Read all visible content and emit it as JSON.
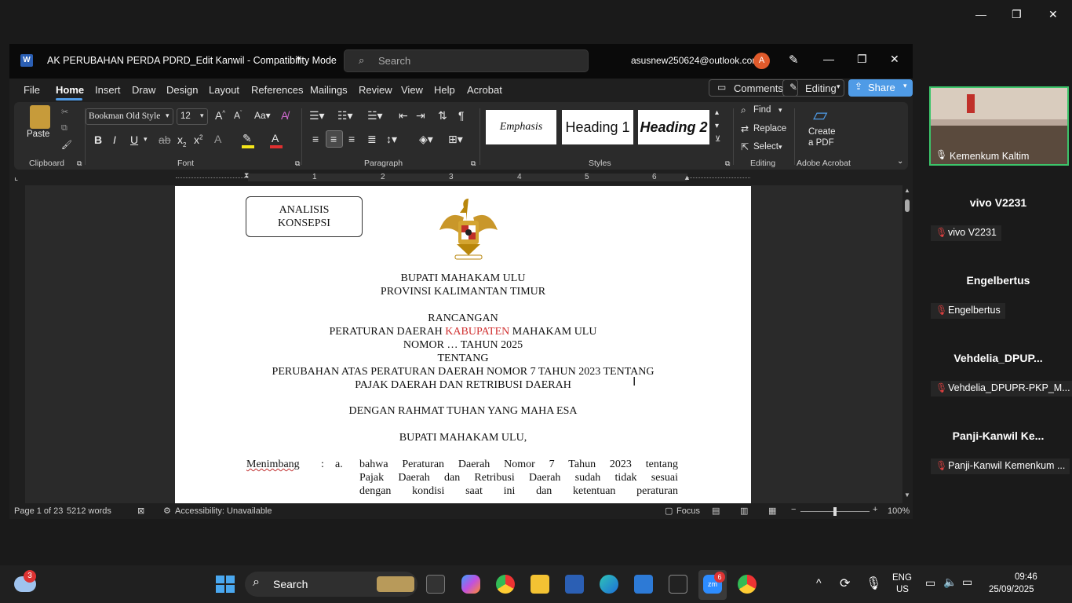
{
  "desktop_controls": {
    "minimize": "—",
    "restore": "❐",
    "close": "✕"
  },
  "word": {
    "title": "AK PERUBAHAN PERDA PDRD_Edit Kanwil  -  Compatibility Mode",
    "search_placeholder": "Search",
    "account": "asusnew250624@outlook.com",
    "avatar_letter": "A",
    "menu": [
      "File",
      "Home",
      "Insert",
      "Draw",
      "Design",
      "Layout",
      "References",
      "Mailings",
      "Review",
      "View",
      "Help",
      "Acrobat"
    ],
    "active_tab": "Home",
    "comments_label": "Comments",
    "editing_label": "Editing",
    "share_label": "Share",
    "ribbon": {
      "paste_label": "Paste",
      "font_name": "Bookman Old Style",
      "font_size": "12",
      "styles": [
        "Emphasis",
        "Heading 1",
        "Heading 2"
      ],
      "find_label": "Find",
      "replace_label": "Replace",
      "select_label": "Select",
      "create_pdf_line1": "Create",
      "create_pdf_line2": "a PDF",
      "groups": {
        "clipboard": "Clipboard",
        "font": "Font",
        "paragraph": "Paragraph",
        "styles": "Styles",
        "editing": "Editing",
        "acrobat": "Adobe Acrobat"
      }
    },
    "ruler_numbers": [
      "1",
      "2",
      "3",
      "4",
      "5",
      "6"
    ],
    "document": {
      "box_line1": "ANALISIS",
      "box_line2": "KONSEPSI",
      "line1": "BUPATI MAHAKAM ULU",
      "line2": "PROVINSI KALIMANTAN TIMUR",
      "line3": "RANCANGAN",
      "line4_a": "PERATURAN DAERAH ",
      "line4_b": "KABUPATEN",
      "line4_c": " MAHAKAM ULU",
      "line5": "NOMOR … TAHUN 2025",
      "line6": "TENTANG",
      "line7": "PERUBAHAN ATAS PERATURAN DAERAH NOMOR 7 TAHUN 2023 TENTANG",
      "line8": "PAJAK DAERAH DAN RETRIBUSI DAERAH",
      "line9": "DENGAN RAHMAT TUHAN YANG MAHA ESA",
      "line10": "BUPATI MAHAKAM ULU,",
      "menimbang": "Menimbang",
      "colon": ":",
      "item_a": "a.",
      "para_l1": "bahwa Peraturan Daerah Nomor 7 Tahun 2023 tentang",
      "para_l2": "Pajak Daerah dan Retribusi Daerah sudah tidak sesuai",
      "para_l3": "dengan  kondisi  saat  ini  dan  ketentuan  peraturan"
    },
    "status": {
      "page": "Page 1 of 23",
      "words": "5212 words",
      "accessibility": "Accessibility: Unavailable",
      "focus": "Focus",
      "zoom": "100%"
    }
  },
  "participants": {
    "video_label": "Kemenkum Kaltim",
    "people": [
      {
        "name": "vivo V2231",
        "tag": "vivo V2231"
      },
      {
        "name": "Engelbertus",
        "tag": "Engelbertus"
      },
      {
        "name": "Vehdelia_DPUP...",
        "tag": "Vehdelia_DPUPR-PKP_M..."
      },
      {
        "name": "Panji-Kanwil  Ke...",
        "tag": "Panji-Kanwil Kemenkum ..."
      }
    ]
  },
  "taskbar": {
    "weather_badge": "3",
    "search_label": "Search",
    "zoom_badge": "6",
    "lang_line1": "ENG",
    "lang_line2": "US",
    "time": "09:46",
    "date": "25/09/2025"
  },
  "colors": {
    "accent": "#4f9be6",
    "red_text": "#d03030",
    "title_bg": "#0a0a0a"
  }
}
